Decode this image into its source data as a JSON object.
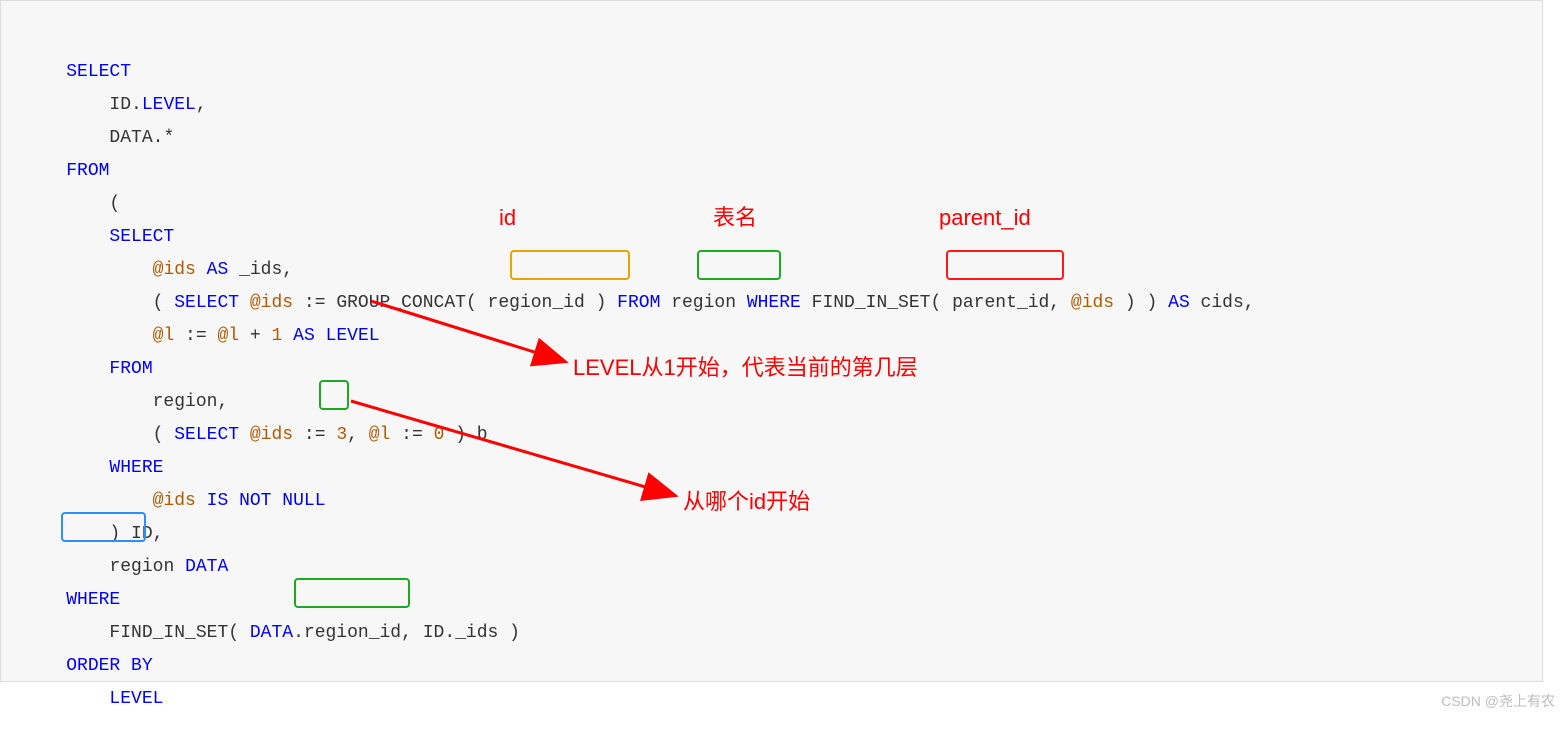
{
  "code": {
    "l1": "SELECT",
    "l2_a": "    ID",
    "l2_b": ".",
    "l2_c": "LEVEL",
    "l2_d": ",",
    "l3_a": "    DATA",
    "l3_b": ".",
    "l3_c": "*",
    "l4": "FROM",
    "l5": "    (",
    "l6": "    SELECT",
    "l7_a": "        ",
    "l7_b": "@ids",
    "l7_c": " AS",
    "l7_d": " _ids,",
    "l8_a": "        ( ",
    "l8_b": "SELECT",
    "l8_c": " ",
    "l8_d": "@ids",
    "l8_e": " :",
    "l8_f": "=",
    "l8_g": " GROUP_CONCAT( ",
    "l8_h": "region_id",
    "l8_i": " ) ",
    "l8_j": "FROM",
    "l8_k": " ",
    "l8_l": "region",
    "l8_m": " ",
    "l8_n": "WHERE",
    "l8_o": " FIND_IN_SET( ",
    "l8_p": "parent_id",
    "l8_q": ", ",
    "l8_r": "@ids",
    "l8_s": " ) ) ",
    "l8_t": "AS",
    "l8_u": " cids,",
    "l9_a": "        ",
    "l9_b": "@l",
    "l9_c": " :",
    "l9_d": "=",
    "l9_e": " ",
    "l9_f": "@l",
    "l9_g": " ",
    "l9_h": "+",
    "l9_i": " ",
    "l9_j": "1",
    "l9_k": " ",
    "l9_l": "AS",
    "l9_m": " ",
    "l9_n": "LEVEL",
    "l10": "    FROM",
    "l11": "        region,",
    "l12_a": "        ( ",
    "l12_b": "SELECT",
    "l12_c": " ",
    "l12_d": "@ids",
    "l12_e": " :",
    "l12_f": "=",
    "l12_g": " ",
    "l12_h": "3",
    "l12_i": ", ",
    "l12_j": "@l",
    "l12_k": " :",
    "l12_l": "=",
    "l12_m": " ",
    "l12_n": "0",
    "l12_o": " ) b",
    "l13": "    WHERE",
    "l14_a": "        ",
    "l14_b": "@ids",
    "l14_c": " ",
    "l14_d": "IS NOT NULL",
    "l15_a": "    ) ID",
    "l15_b": ",",
    "l16_a": "    ",
    "l16_b": "region",
    "l16_c": " ",
    "l16_d": "DATA",
    "l17": "WHERE",
    "l18_a": "    FIND_IN_SET( ",
    "l18_b": "DATA",
    "l18_c": ".",
    "l18_d": "region_id",
    "l18_e": ", ID._ids )",
    "l19": "ORDER BY",
    "l20": "    LEVEL"
  },
  "labels": {
    "id": "id",
    "table": "表名",
    "parent": "parent_id",
    "level_note": "LEVEL从1开始，代表当前的第几层",
    "start_note": "从哪个id开始"
  },
  "watermark": "CSDN @尧上有农"
}
